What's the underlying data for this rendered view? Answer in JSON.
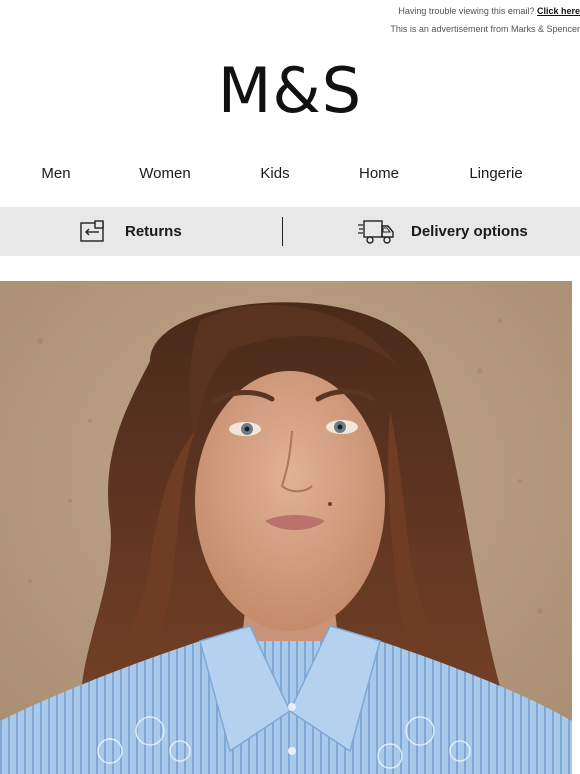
{
  "preheader": {
    "trouble_text": "Having trouble viewing this email?",
    "click_here_label": "Click here",
    "ad_notice": "This is an advertisement from Marks & Spencer"
  },
  "brand": {
    "logo_text": "M&S"
  },
  "nav": {
    "items": [
      {
        "label": "Men"
      },
      {
        "label": "Women"
      },
      {
        "label": "Kids"
      },
      {
        "label": "Home"
      },
      {
        "label": "Lingerie"
      }
    ]
  },
  "service_bar": {
    "returns_label": "Returns",
    "returns_icon": "returns-icon",
    "delivery_label": "Delivery options",
    "delivery_icon": "delivery-van-icon"
  },
  "hero": {
    "image_subject": "hero-image",
    "colors": {
      "background_wall": "#b69b80",
      "hair": "#6b3a22",
      "skin": "#d9a585",
      "shirt": "#9fc3e6"
    }
  }
}
